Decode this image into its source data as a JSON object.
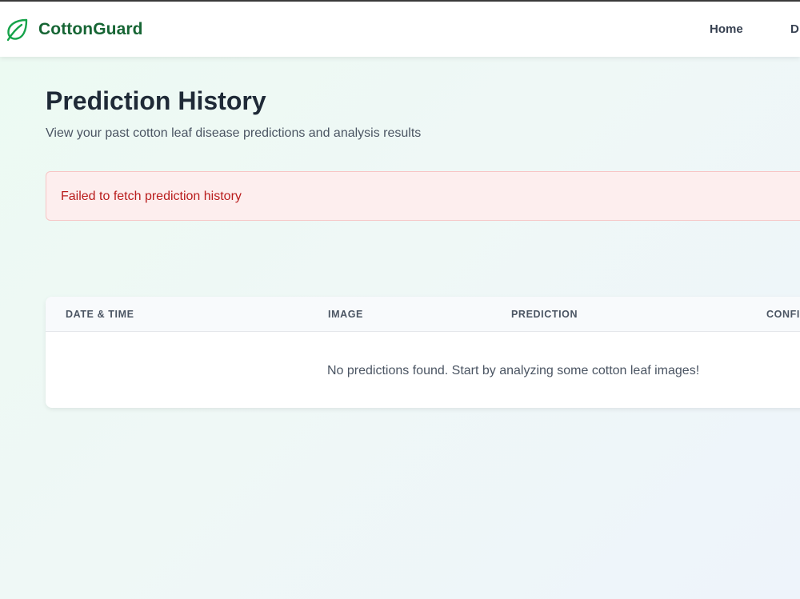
{
  "navbar": {
    "brand": "CottonGuard",
    "brand_icon": "leaf-icon",
    "brand_color": "#166534",
    "links": [
      {
        "label": "Home"
      },
      {
        "label": "D"
      }
    ]
  },
  "page": {
    "title": "Prediction History",
    "subtitle": "View your past cotton leaf disease predictions and analysis results"
  },
  "error": {
    "message": "Failed to fetch prediction history",
    "color": "#b91c1c"
  },
  "table": {
    "columns": [
      "DATE & TIME",
      "IMAGE",
      "PREDICTION",
      "CONFI"
    ],
    "empty_message": "No predictions found. Start by analyzing some cotton leaf images!"
  }
}
